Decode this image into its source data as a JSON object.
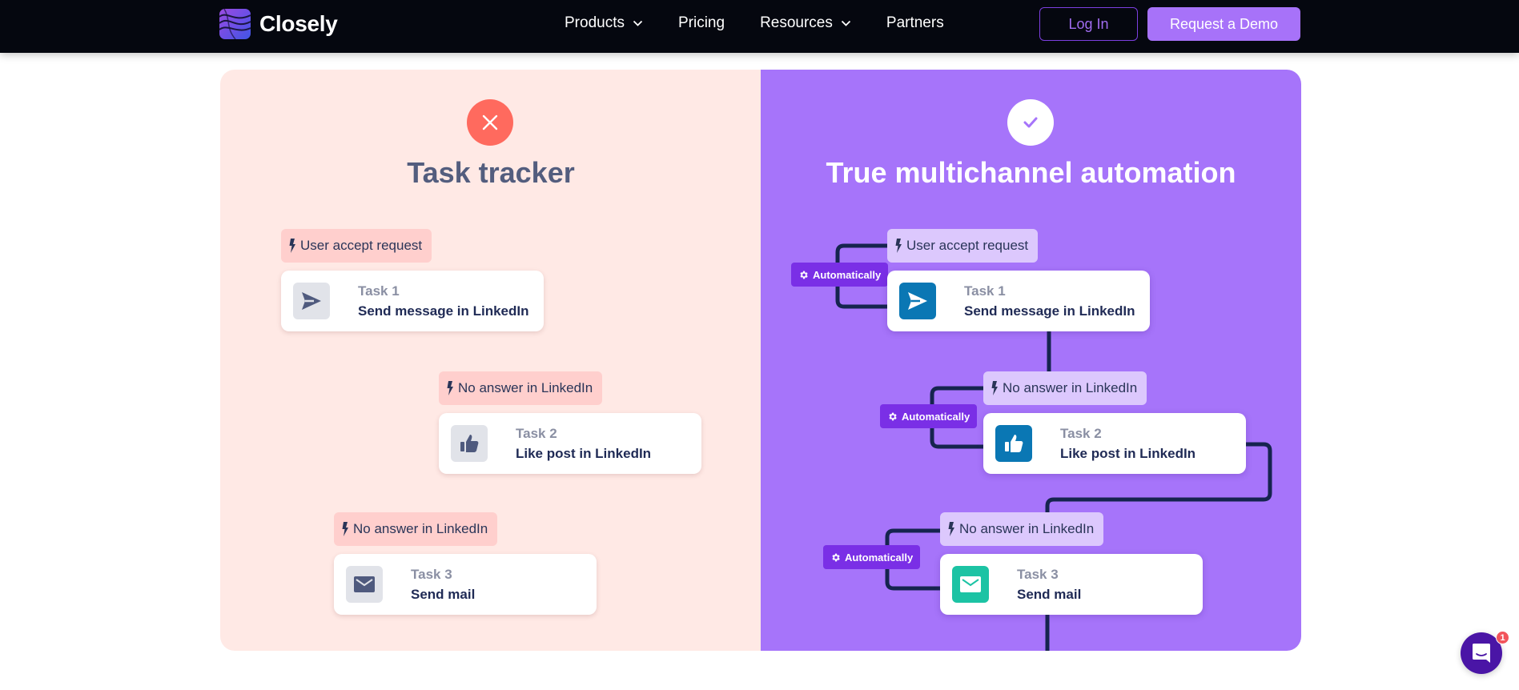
{
  "nav": {
    "brand": "Closely",
    "links": [
      {
        "label": "Products",
        "has_dropdown": true
      },
      {
        "label": "Pricing",
        "has_dropdown": false
      },
      {
        "label": "Resources",
        "has_dropdown": true
      },
      {
        "label": "Partners",
        "has_dropdown": false
      }
    ],
    "login_label": "Log In",
    "demo_label": "Request a Demo"
  },
  "comparison": {
    "left": {
      "title": "Task tracker",
      "status_icon": "close-icon",
      "status_color": "#ff6a5e",
      "steps": [
        {
          "trigger": "User accept request",
          "task": "Task 1",
          "action": "Send message in LinkedIn",
          "icon": "send-icon"
        },
        {
          "trigger": "No answer in LinkedIn",
          "task": "Task 2",
          "action": "Like post in LinkedIn",
          "icon": "thumbs-up-icon"
        },
        {
          "trigger": "No answer in LinkedIn",
          "task": "Task 3",
          "action": "Send mail",
          "icon": "mail-icon"
        }
      ]
    },
    "right": {
      "title": "True multichannel automation",
      "status_icon": "check-icon",
      "status_color": "#ffffff",
      "auto_label": "Automatically",
      "steps": [
        {
          "trigger": "User accept request",
          "task": "Task 1",
          "action": "Send message in LinkedIn",
          "icon": "send-icon"
        },
        {
          "trigger": "No answer in LinkedIn",
          "task": "Task 2",
          "action": "Like post in LinkedIn",
          "icon": "thumbs-up-icon"
        },
        {
          "trigger": "No answer in LinkedIn",
          "task": "Task 3",
          "action": "Send mail",
          "icon": "mail-icon"
        }
      ]
    }
  },
  "chat": {
    "unread_count": "1"
  },
  "colors": {
    "nav_bg": "#05070f",
    "accent": "#a772f9",
    "left_panel_bg": "#ffe9e5",
    "right_panel_bg": "#a674fa",
    "linkedin_blue": "#0a77b4",
    "mail_teal": "#1cc3a4",
    "auto_badge": "#7a2fe6",
    "connector": "#16244f"
  }
}
